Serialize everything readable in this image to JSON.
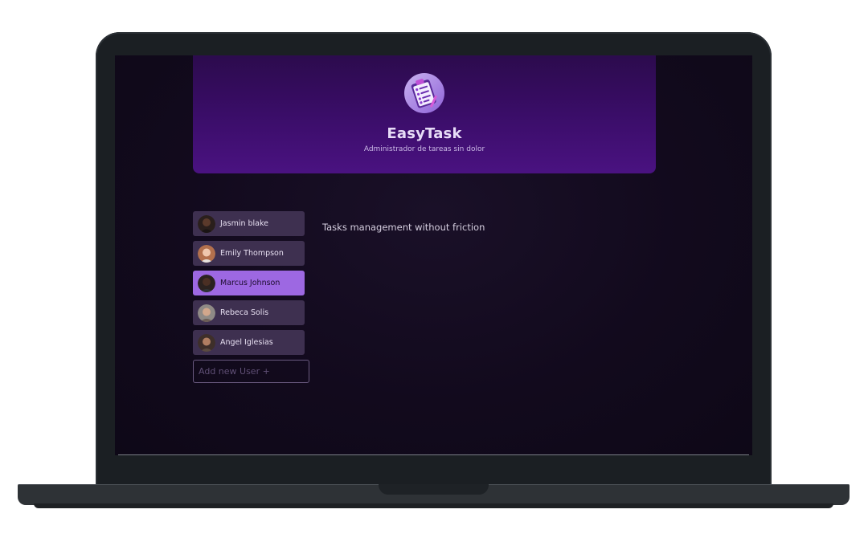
{
  "app": {
    "title": "EasyTask",
    "subtitle": "Administrador de tareas sin dolor",
    "logo_icon": "clipboard-checklist-icon"
  },
  "users": {
    "items": [
      {
        "name": "Jasmin blake",
        "avatar_color": "#3a2a22"
      },
      {
        "name": "Emily Thompson",
        "avatar_color": "#c88d6e"
      },
      {
        "name": "Marcus Johnson",
        "avatar_color": "#3b2a24",
        "selected": true
      },
      {
        "name": "Rebeca Solis",
        "avatar_color": "#a78a74"
      },
      {
        "name": "Angel Iglesias",
        "avatar_color": "#5a3c30"
      }
    ],
    "add_placeholder": "Add new User +"
  },
  "main": {
    "message": "Tasks management without friction"
  },
  "colors": {
    "header_top": "#2c0b4d",
    "header_bottom": "#4a1281",
    "user_item": "#3e3050",
    "user_item_selected": "#9d68e2",
    "background": "#120a1d"
  }
}
